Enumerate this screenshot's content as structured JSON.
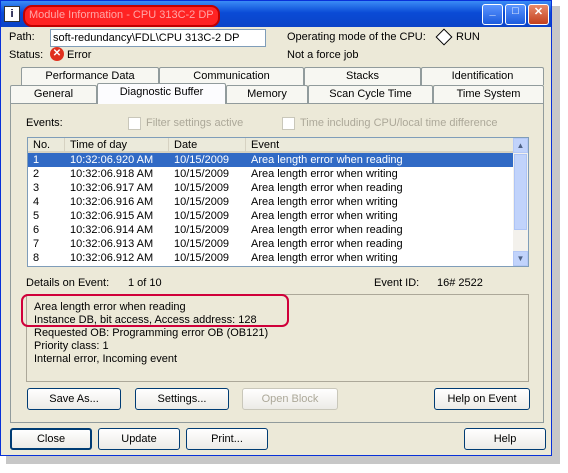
{
  "window": {
    "title": "Module Information - CPU 313C-2 DP",
    "app_icon": "i",
    "minimize_glyph": "_",
    "maximize_glyph": "□",
    "close_glyph": "✕"
  },
  "header": {
    "path_label": "Path:",
    "path_value": "soft-redundancy\\FDL\\CPU 313C-2 DP",
    "status_label": "Status:",
    "status_value": "Error",
    "status_icon": "error-icon",
    "mode_label": "Operating mode of the  CPU:",
    "mode_value": "RUN",
    "force_text": "Not a force job"
  },
  "tabs_row1": [
    "Performance Data",
    "Communication",
    "Stacks",
    "Identification"
  ],
  "tabs_row2": [
    "General",
    "Diagnostic Buffer",
    "Memory",
    "Scan Cycle Time",
    "Time System"
  ],
  "active_tab": "Diagnostic Buffer",
  "events": {
    "label": "Events:",
    "filter_label": "Filter settings active",
    "time_label": "Time including CPU/local time difference",
    "columns": [
      "No.",
      "Time of day",
      "Date",
      "Event"
    ],
    "rows": [
      {
        "no": "1",
        "time": "10:32:06.920 AM",
        "date": "10/15/2009",
        "event": "Area length error when reading"
      },
      {
        "no": "2",
        "time": "10:32:06.918 AM",
        "date": "10/15/2009",
        "event": "Area length error when writing"
      },
      {
        "no": "3",
        "time": "10:32:06.917 AM",
        "date": "10/15/2009",
        "event": "Area length error when reading"
      },
      {
        "no": "4",
        "time": "10:32:06.916 AM",
        "date": "10/15/2009",
        "event": "Area length error when writing"
      },
      {
        "no": "5",
        "time": "10:32:06.915 AM",
        "date": "10/15/2009",
        "event": "Area length error when writing"
      },
      {
        "no": "6",
        "time": "10:32:06.914 AM",
        "date": "10/15/2009",
        "event": "Area length error when reading"
      },
      {
        "no": "7",
        "time": "10:32:06.913 AM",
        "date": "10/15/2009",
        "event": "Area length error when reading"
      },
      {
        "no": "8",
        "time": "10:32:06.912 AM",
        "date": "10/15/2009",
        "event": "Area length error when writing"
      }
    ],
    "selected_index": 0
  },
  "details": {
    "label": "Details on Event:",
    "counter": "1 of 10",
    "event_id_label": "Event ID:",
    "event_id_value": "16# 2522",
    "lines": [
      "Area length error when reading",
      "Instance DB, bit access, Access address:     128",
      "Requested OB: Programming error OB (OB121)",
      "Priority class:  1",
      "Internal error, Incoming event"
    ]
  },
  "panel_buttons": {
    "save_as": "Save As...",
    "settings": "Settings...",
    "open_block": "Open Block",
    "help_on_event": "Help on Event"
  },
  "footer_buttons": {
    "close": "Close",
    "update": "Update",
    "print": "Print...",
    "help": "Help"
  }
}
